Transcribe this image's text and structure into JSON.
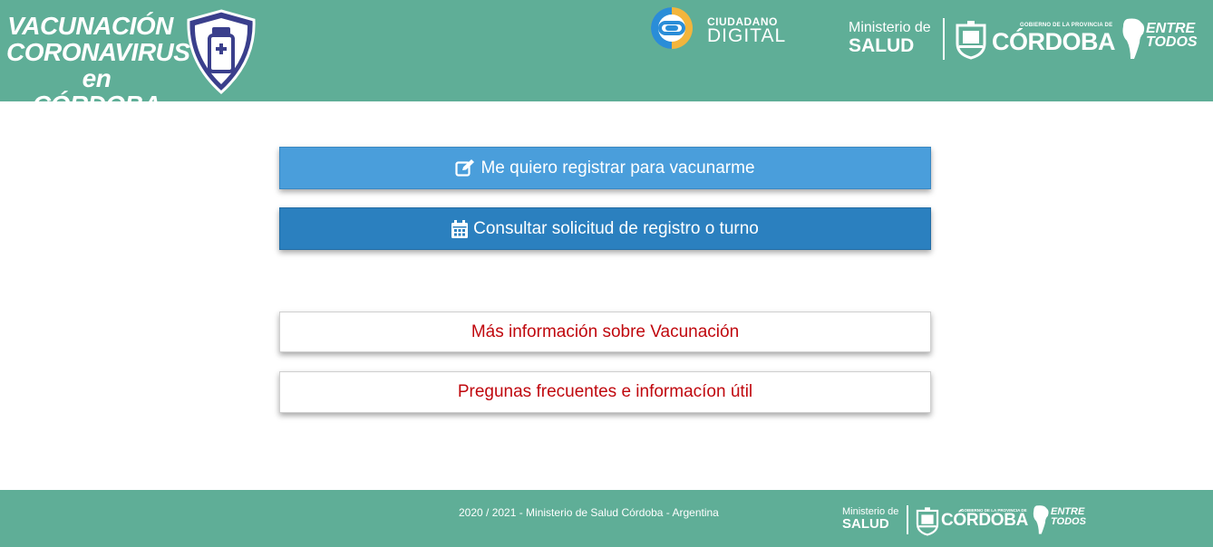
{
  "header": {
    "campaign": {
      "line1": "VACUNACIÓN",
      "line2": "CORONAVIRUS",
      "line3": "en CÓRDOBA"
    },
    "ciudadano": {
      "top": "CIUDADANO",
      "bottom": "DIGITAL"
    },
    "ministerio": {
      "line1": "Ministerio de",
      "line2": "SALUD"
    },
    "gobierno_small": "GOBIERNO DE LA PROVINCIA DE",
    "cordoba": "CÓRDOBA",
    "entre_todos": {
      "line1": "ENTRE",
      "line2": "TODOS"
    }
  },
  "actions": {
    "register_label": "Me quiero registrar para vacunarme",
    "consult_label": "Consultar solicitud de registro o turno",
    "info_label": "Más información sobre Vacunación",
    "faq_label": "Pregunas frecuentes e informacíon útil"
  },
  "footer": {
    "copyright": "2020 / 2021 - Ministerio de Salud Córdoba - Argentina",
    "ministerio": {
      "line1": "Ministerio de",
      "line2": "SALUD"
    },
    "gobierno_small": "GOBIERNO DE LA PROVINCIA DE",
    "cordoba": "CÓRDOBA",
    "entre_todos": {
      "line1": "ENTRE",
      "line2": "TODOS"
    }
  },
  "colors": {
    "header_bg": "#5fae97",
    "register_bg": "#4a9edb",
    "consult_bg": "#2b80bf",
    "link_red": "#c0080e"
  },
  "icons": [
    "shield-vaccine-icon",
    "ciudadano-digital-logo",
    "cordoba-shield-icon",
    "argentina-map-icon",
    "edit-icon",
    "calendar-icon"
  ]
}
